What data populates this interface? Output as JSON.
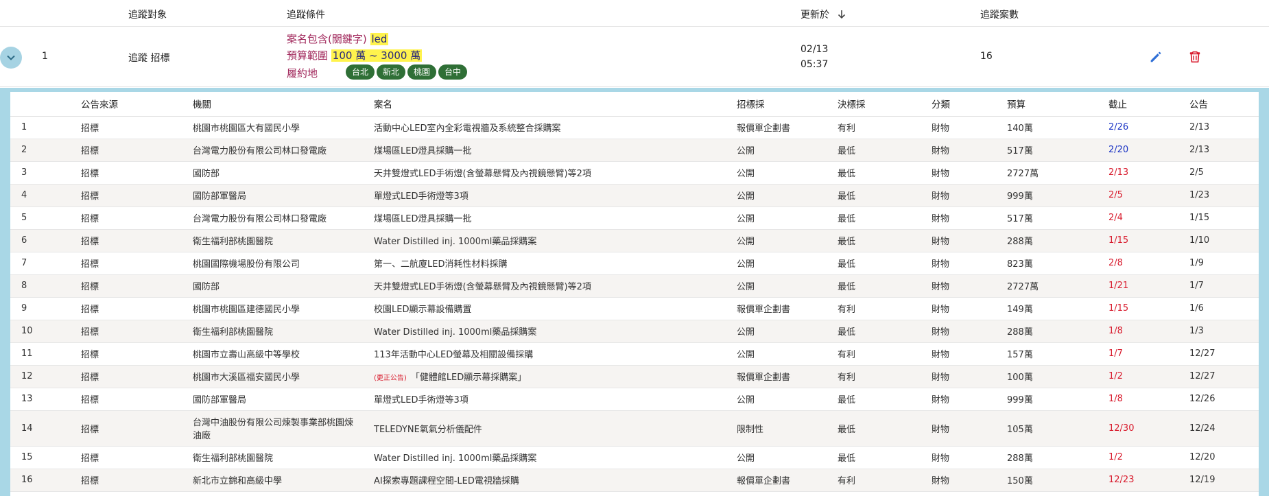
{
  "outer_header": {
    "target": "追蹤對象",
    "conditions": "追蹤條件",
    "updated": "更新於",
    "count": "追蹤案數"
  },
  "tracker": {
    "index": "1",
    "target": "追蹤 招標",
    "keyword_label": "案名包含(關鍵字)",
    "keyword": "led",
    "budget_label": "預算範圍",
    "budget": "100 萬 ~ 3000 萬",
    "location_label": "履約地",
    "locations": [
      "台北",
      "新北",
      "桃園",
      "台中"
    ],
    "updated_date": "02/13",
    "updated_time": "05:37",
    "count": "16"
  },
  "colors": {
    "accent": "#2f6fd6",
    "danger": "#d81a2c",
    "chip": "#2f6f36",
    "panel": "#a9d7e6"
  },
  "table": {
    "headers": [
      "公告來源",
      "機關",
      "案名",
      "招標採",
      "決標採",
      "分類",
      "預算",
      "截止",
      "公告"
    ],
    "rows": [
      [
        "1",
        "招標",
        "桃園市桃園區大有國民小學",
        "活動中心LED室內全彩電視牆及系統整合採購案",
        "報價單企劃書",
        "有利",
        "財物",
        "140萬",
        "2/26",
        "2/13"
      ],
      [
        "2",
        "招標",
        "台灣電力股份有限公司林口發電廠",
        "煤場區LED燈具採購一批",
        "公開",
        "最低",
        "財物",
        "517萬",
        "2/20",
        "2/13"
      ],
      [
        "3",
        "招標",
        "國防部",
        "天井雙燈式LED手術燈(含螢幕懸臂及內視鏡懸臂)等2項",
        "公開",
        "最低",
        "財物",
        "2727萬",
        "2/13",
        "2/5"
      ],
      [
        "4",
        "招標",
        "國防部軍醫局",
        "單燈式LED手術燈等3項",
        "公開",
        "最低",
        "財物",
        "999萬",
        "2/5",
        "1/23"
      ],
      [
        "5",
        "招標",
        "台灣電力股份有限公司林口發電廠",
        "煤場區LED燈具採購一批",
        "公開",
        "最低",
        "財物",
        "517萬",
        "2/4",
        "1/15"
      ],
      [
        "6",
        "招標",
        "衛生福利部桃園醫院",
        "Water Distilled inj. 1000ml藥品採購案",
        "公開",
        "最低",
        "財物",
        "288萬",
        "1/15",
        "1/10"
      ],
      [
        "7",
        "招標",
        "桃園國際機場股份有限公司",
        "第一、二航廈LED消耗性材料採購",
        "公開",
        "最低",
        "財物",
        "823萬",
        "2/8",
        "1/9"
      ],
      [
        "8",
        "招標",
        "國防部",
        "天井雙燈式LED手術燈(含螢幕懸臂及內視鏡懸臂)等2項",
        "公開",
        "最低",
        "財物",
        "2727萬",
        "1/21",
        "1/7"
      ],
      [
        "9",
        "招標",
        "桃園市桃園區建德國民小學",
        "校園LED顯示幕設備購置",
        "報價單企劃書",
        "有利",
        "財物",
        "149萬",
        "1/15",
        "1/6"
      ],
      [
        "10",
        "招標",
        "衛生福利部桃園醫院",
        "Water Distilled inj. 1000ml藥品採購案",
        "公開",
        "最低",
        "財物",
        "288萬",
        "1/8",
        "1/3"
      ],
      [
        "11",
        "招標",
        "桃園市立壽山高級中等學校",
        "113年活動中心LED螢幕及相關設備採購",
        "公開",
        "有利",
        "財物",
        "157萬",
        "1/7",
        "12/27"
      ],
      [
        "12",
        "招標",
        "桃園市大溪區福安國民小學",
        "「健體館LED顯示幕採購案」",
        "報價單企劃書",
        "有利",
        "財物",
        "100萬",
        "1/2",
        "12/27"
      ],
      [
        "13",
        "招標",
        "國防部軍醫局",
        "單燈式LED手術燈等3項",
        "公開",
        "最低",
        "財物",
        "999萬",
        "1/8",
        "12/26"
      ],
      [
        "14",
        "招標",
        "台灣中油股份有限公司煉製事業部桃園煉油廠",
        "TELEDYNE氧氣分析儀配件",
        "限制性",
        "最低",
        "財物",
        "105萬",
        "12/30",
        "12/24"
      ],
      [
        "15",
        "招標",
        "衛生福利部桃園醫院",
        "Water Distilled inj. 1000ml藥品採購案",
        "公開",
        "最低",
        "財物",
        "288萬",
        "1/2",
        "12/20"
      ],
      [
        "16",
        "招標",
        "新北市立錦和高級中學",
        "AI探索專題課程空間-LED電視牆採購",
        "報價單企劃書",
        "有利",
        "財物",
        "150萬",
        "12/23",
        "12/19"
      ]
    ],
    "row12_prefix": "(更正公告)",
    "deadline_colors": [
      "blue",
      "blue",
      "red",
      "red",
      "red",
      "red",
      "red",
      "red",
      "red",
      "red",
      "red",
      "red",
      "red",
      "red",
      "red",
      "red"
    ]
  }
}
